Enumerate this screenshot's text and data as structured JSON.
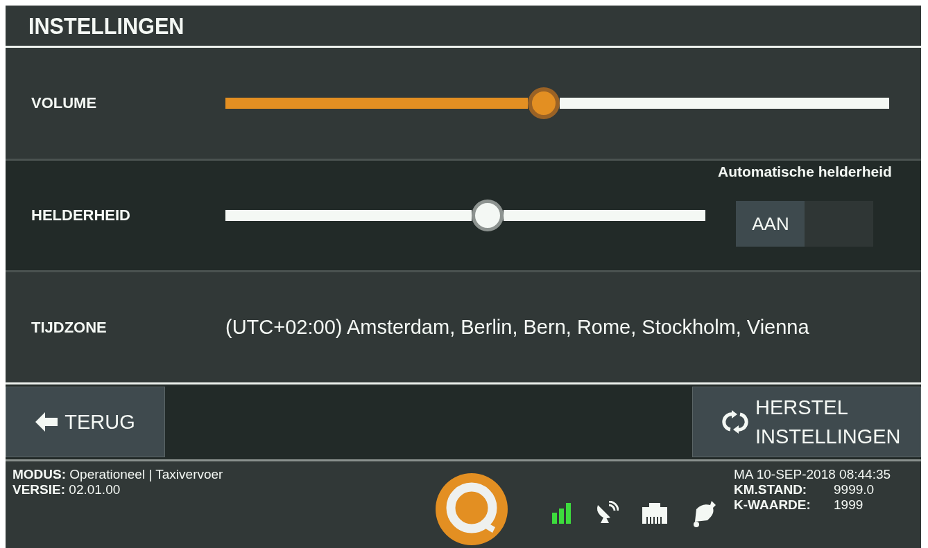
{
  "window": {
    "title": "INSTELLINGEN"
  },
  "settings": [
    {
      "kind": "slider",
      "label": "VOLUME",
      "level": 0.48
    },
    {
      "kind": "slider",
      "label": "HELDERHEID",
      "level": 0.546,
      "toggle": {
        "label": "Automatische helderheid",
        "state_text": "AAN",
        "on": true
      }
    },
    {
      "kind": "text",
      "label": "TIJDZONE",
      "value": "(UTC+02:00) Amsterdam, Berlin, Bern, Rome, Stockholm, Vienna"
    }
  ],
  "buttons": [
    {
      "kind": "back",
      "label": "TERUG"
    },
    {
      "kind": "reset",
      "label": "HERSTEL INSTELLINGEN"
    }
  ],
  "status_bar": {
    "modus_label": "MODUS:",
    "modus": "Operationeel | Taxivervoer",
    "versie_label": "VERSIE:",
    "versie": "02.01.00",
    "datetime": "MA 10-SEP-2018 08:44:35",
    "km_label": "KM.STAND:",
    "km": "9999.0",
    "k_label": "K-WAARDE:",
    "k": "1999"
  }
}
